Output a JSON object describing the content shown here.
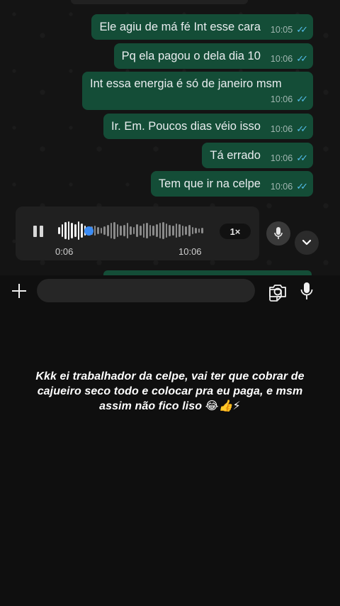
{
  "messages": [
    {
      "text": "Ele agiu de má fé Int esse cara",
      "time": "10:05"
    },
    {
      "text": "Pq ela pagou o dela dia 10",
      "time": "10:06"
    },
    {
      "text": "Int essa energia é só de janeiro msm",
      "time": "10:06"
    },
    {
      "text": "Ir. Em. Poucos dias véio isso",
      "time": "10:06"
    },
    {
      "text": "Tá errado",
      "time": "10:06"
    },
    {
      "text": "Tem que ir na celpe",
      "time": "10:06"
    }
  ],
  "voice_note": {
    "elapsed": "0:06",
    "timestamp": "10:06",
    "speed": "1×",
    "progress": 0.2
  },
  "caption": "Kkk ei trabalhador da celpe, vai ter que cobrar de cajueiro seco todo e colocar pra eu paga,  e msm assim não fico liso 😂👍⚡",
  "colors": {
    "bubble": "#144d37",
    "read_ticks": "#53bdeb",
    "playhead": "#3b8cf5"
  },
  "icons": {
    "attach": "plus-icon",
    "sticker": "sticker-icon",
    "camera": "camera-icon",
    "voice": "microphone-icon",
    "scroll": "chevron-down-icon",
    "player": "pause-icon"
  }
}
